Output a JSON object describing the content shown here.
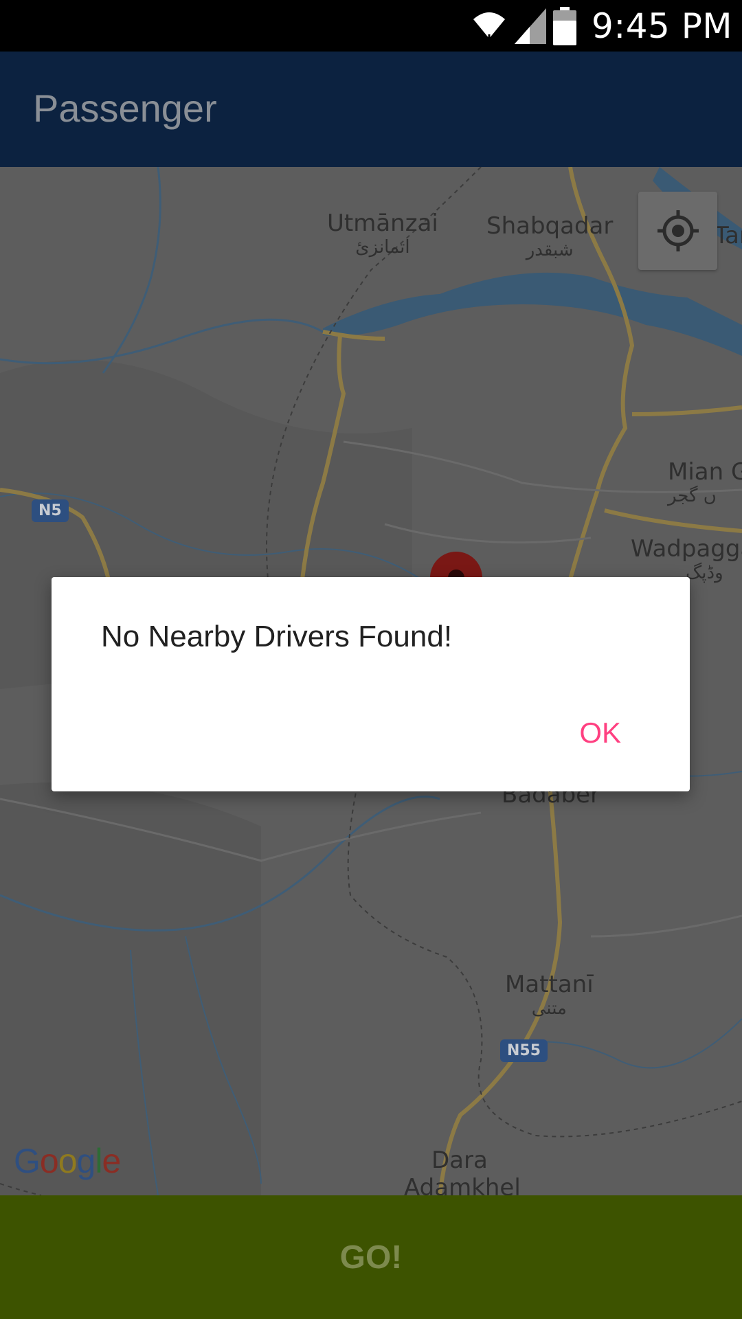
{
  "status_bar": {
    "time": "9:45 PM",
    "icons": [
      "wifi-icon",
      "signal-icon",
      "battery-icon"
    ]
  },
  "app_bar": {
    "title": "Passenger"
  },
  "map": {
    "places": [
      {
        "name": "Utmānzai",
        "urdu": "اتمانزئ"
      },
      {
        "name": "Shabqadar",
        "urdu": "شبقدر"
      },
      {
        "name": "Tarn",
        "urdu": ""
      },
      {
        "name": "Mian G",
        "urdu": "ں گجر"
      },
      {
        "name": "Wadpagga",
        "urdu": "وڈپگ"
      },
      {
        "name": "Badaber",
        "urdu": ""
      },
      {
        "name": "Mattanī",
        "urdu": "متنی"
      },
      {
        "name": "Dara",
        "urdu": ""
      },
      {
        "name": "Adamkhel",
        "urdu": ""
      }
    ],
    "highway_shields": [
      "N5",
      "N55"
    ],
    "attribution": "Google",
    "my_location_icon": "crosshair-icon",
    "marker_icon": "map-pin-icon"
  },
  "dialog": {
    "message": "No Nearby Drivers Found!",
    "ok_label": "OK"
  },
  "go_button": {
    "label": "GO!"
  },
  "colors": {
    "app_bar": "#0c2240",
    "accent": "#ff4081",
    "go_bar": "#3d5300",
    "marker": "#b0201c"
  }
}
